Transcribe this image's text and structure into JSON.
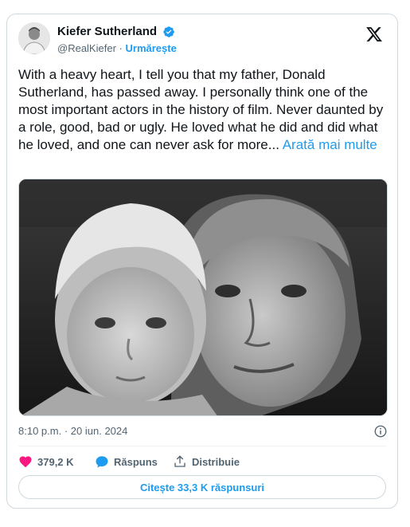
{
  "author": {
    "display_name": "Kiefer Sutherland",
    "handle": "@RealKiefer",
    "separator": "·",
    "follow_label": "Urmărește",
    "verified": true
  },
  "tweet": {
    "text": "With a heavy heart, I tell you that my father, Donald Sutherland, has passed away. I personally think one of the most important actors in the history of film. Never daunted by a role, good, bad or ugly. He loved what he did and did what he loved, and one can never ask for more...",
    "show_more": "Arată mai multe",
    "media_icon": "photo"
  },
  "meta": {
    "time": "8:10 p.m.",
    "separator": "·",
    "date": "20 iun. 2024"
  },
  "actions": {
    "likes": "379,2 K",
    "reply_label": "Răspuns",
    "share_label": "Distribuie"
  },
  "read_replies": "Citește 33,3 K răspunsuri",
  "colors": {
    "accent": "#1d9bf0",
    "like": "#f91880",
    "text": "#0f1419",
    "muted": "#536471",
    "border": "#cfd9de"
  },
  "icons": [
    "verified-badge-icon",
    "x-logo-icon",
    "info-icon",
    "heart-icon",
    "reply-bubble-icon",
    "share-icon"
  ]
}
